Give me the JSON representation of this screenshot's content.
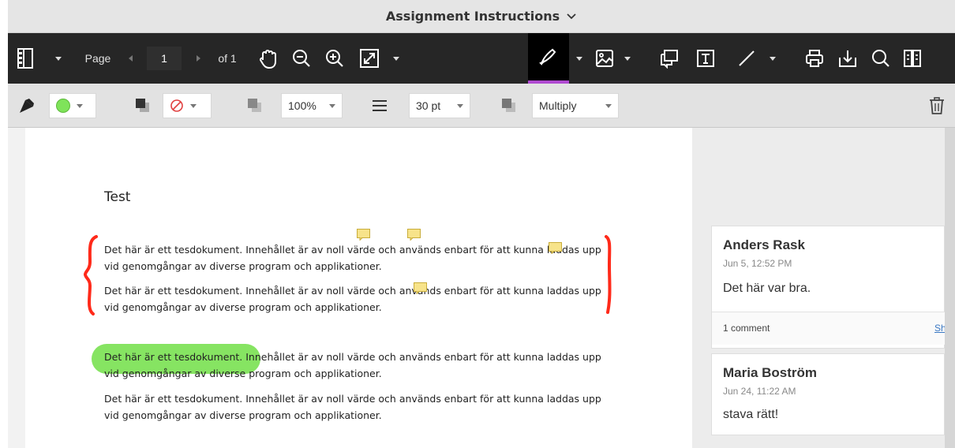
{
  "window": {
    "title": "Assignment Instructions"
  },
  "toolbar": {
    "page_label": "Page",
    "page_value": "1",
    "page_total": "of 1",
    "icons": [
      "sidebar-toggle-icon",
      "pan-hand-icon",
      "zoom-out-icon",
      "zoom-in-icon",
      "fit-page-icon",
      "freehand-pen-icon",
      "image-icon",
      "comment-icon",
      "text-box-icon",
      "line-icon",
      "print-icon",
      "download-icon",
      "search-icon",
      "compare-icon"
    ]
  },
  "subbar": {
    "stroke_color": "#7fe35a",
    "opacity_value": "100%",
    "size_value": "30 pt",
    "blend_value": "Multiply",
    "icons": [
      "ink-color-icon",
      "border-color-icon",
      "no-fill-icon",
      "opacity-icon",
      "line-width-icon",
      "blend-mode-icon",
      "delete-icon"
    ]
  },
  "document": {
    "title": "Test",
    "paragraphs": [
      {
        "line1": "Det här är ett tesdokument. Innehållet är av noll värde och används enbart för att kunna laddas upp",
        "line2": "vid genomgångar av diverse program och applikationer."
      },
      {
        "line1": "Det här är ett tesdokument. Innehållet är av noll värde och används enbart för att kunna laddas upp",
        "line2": "vid genomgångar av diverse program och applikationer."
      },
      {
        "line1": "Det här är ett tesdokument. Innehållet är av noll värde och används enbart för att kunna laddas upp",
        "line2": "vid genomgångar av diverse program och applikationer."
      },
      {
        "line1": "Det här är ett tesdokument. Innehållet är av noll värde och används enbart för att kunna laddas upp",
        "line2": "vid genomgångar av diverse program och applikationer."
      }
    ],
    "annotation_colors": {
      "bracket": "#ff2a1a",
      "highlight": "#7fe35a",
      "note": "#f7e38a"
    }
  },
  "comments": [
    {
      "author": "Anders Rask",
      "date": "Jun 5, 12:52 PM",
      "body": "Det här var bra.",
      "count": "1 comment",
      "show": "Sh"
    },
    {
      "author": "Maria Boström",
      "date": "Jun 24, 11:22 AM",
      "body": "stava rätt!"
    }
  ]
}
